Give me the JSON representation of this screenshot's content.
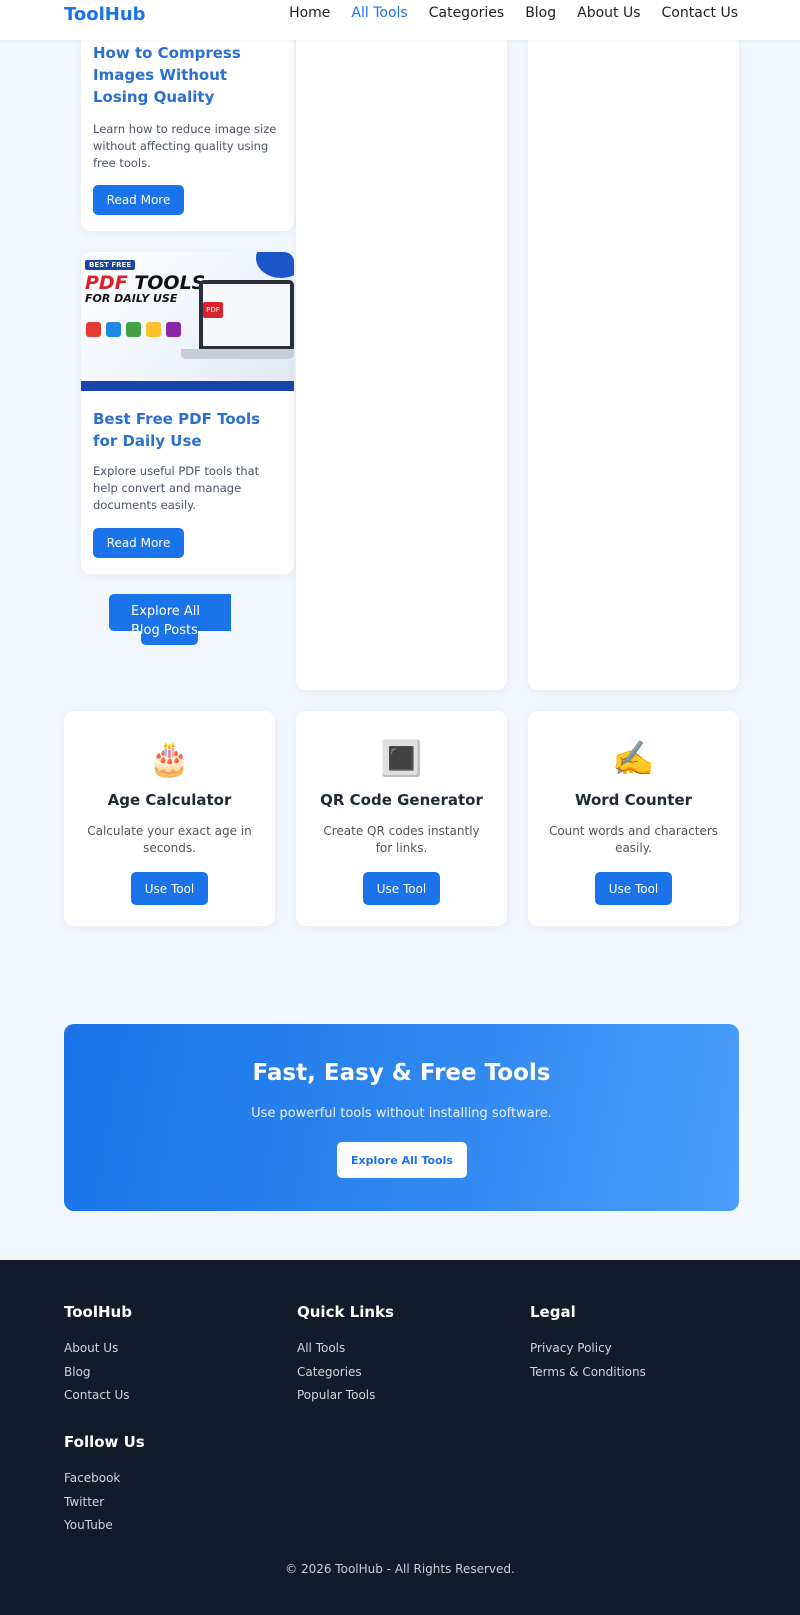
{
  "header": {
    "logo": "ToolHub",
    "nav": [
      "Home",
      "All Tools",
      "Categories",
      "Blog",
      "About Us",
      "Contact Us"
    ],
    "active_nav": "All Tools"
  },
  "blog": {
    "posts": [
      {
        "title": "How to Compress Images Without Losing Quality",
        "description": "Learn how to reduce image size without affecting quality using free tools.",
        "button": "Read More"
      },
      {
        "title": "Best Free PDF Tools for Daily Use",
        "description": "Explore useful PDF tools that help convert and manage documents easily.",
        "button": "Read More",
        "thumbnail": {
          "badge": "BEST FREE",
          "headline_red": "PDF",
          "headline_dark": "TOOLS",
          "subline": "FOR DAILY USE",
          "doc_label": "PDF"
        }
      }
    ],
    "explore_button": "Explore All Blog Posts"
  },
  "tools": [
    {
      "icon": "🎂",
      "icon_name": "birthday-cake-icon",
      "name": "Age Calculator",
      "description": "Calculate your exact age in seconds.",
      "button": "Use Tool"
    },
    {
      "icon": "🔳",
      "icon_name": "qr-square-icon",
      "name": "QR Code Generator",
      "description": "Create QR codes instantly for links.",
      "button": "Use Tool"
    },
    {
      "icon": "✍️",
      "icon_name": "writing-hand-icon",
      "name": "Word Counter",
      "description": "Count words and characters easily.",
      "button": "Use Tool"
    }
  ],
  "cta": {
    "title": "Fast, Easy & Free Tools",
    "subtitle": "Use powerful tools without installing software.",
    "button": "Explore All Tools"
  },
  "footer": {
    "columns": [
      {
        "heading": "ToolHub",
        "links": [
          "About Us",
          "Blog",
          "Contact Us"
        ]
      },
      {
        "heading": "Quick Links",
        "links": [
          "All Tools",
          "Categories",
          "Popular Tools"
        ]
      },
      {
        "heading": "Legal",
        "links": [
          "Privacy Policy",
          "Terms & Conditions"
        ]
      },
      {
        "heading": "Follow Us",
        "links": [
          "Facebook",
          "Twitter",
          "YouTube"
        ]
      }
    ],
    "copyright": "© 2026 ToolHub - All Rights Reserved."
  },
  "colors": {
    "primary": "#1a73e8",
    "page_bg": "#f2f6fd",
    "footer_bg": "#121a2c",
    "blog_title": "#2b6fd1"
  }
}
